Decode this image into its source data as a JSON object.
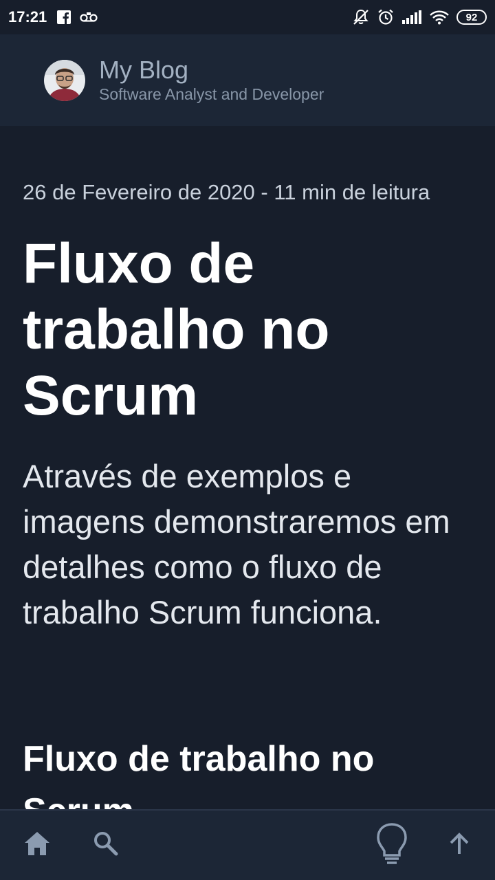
{
  "status_bar": {
    "time": "17:21",
    "battery": "92"
  },
  "header": {
    "title": "My Blog",
    "subtitle": "Software Analyst and Developer"
  },
  "article": {
    "meta": "26 de Fevereiro de 2020 - 11 min de leitura",
    "title": "Fluxo de trabalho no Scrum",
    "lead": "Através de exemplos e imagens demonstraremos em detalhes como o fluxo de trabalho Scrum funciona.",
    "section_heading": "Fluxo de trabalho no Scrum"
  },
  "bottom_nav": {
    "icons": [
      "home-icon",
      "search-icon",
      "lightbulb-icon",
      "arrow-up-icon"
    ]
  },
  "colors": {
    "background": "#171e2b",
    "header_bg": "#1c2636",
    "muted_text": "#a3b1c2"
  }
}
